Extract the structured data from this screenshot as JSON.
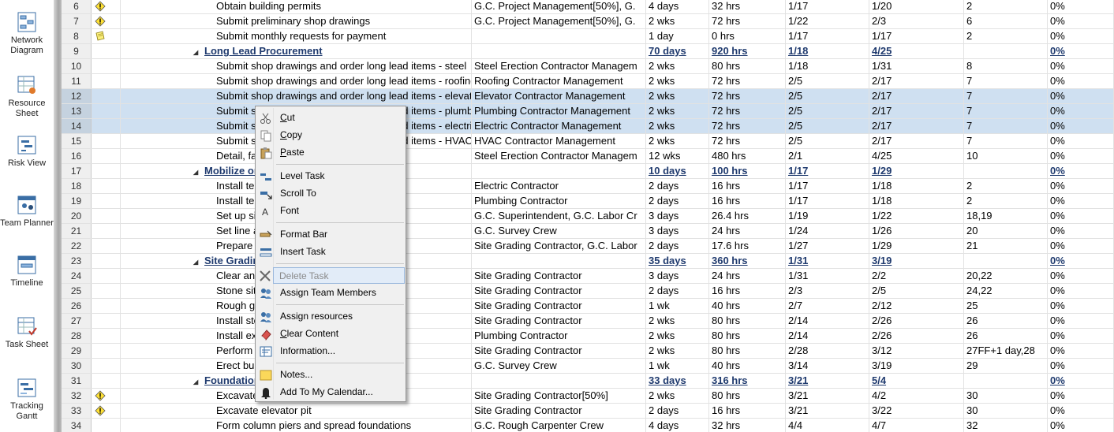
{
  "views": [
    {
      "label": "Network Diagram",
      "icon": "network-diagram-icon"
    },
    {
      "label": "Resource Sheet",
      "icon": "resource-sheet-icon"
    },
    {
      "label": "Risk View",
      "icon": "risk-view-icon"
    },
    {
      "label": "Team Planner",
      "icon": "team-planner-icon"
    },
    {
      "label": "Timeline",
      "icon": "timeline-icon"
    },
    {
      "label": "Task Sheet",
      "icon": "task-sheet-icon"
    },
    {
      "label": "Tracking Gantt",
      "icon": "tracking-gantt-icon"
    }
  ],
  "rows": [
    {
      "id": "6",
      "ind": "warning",
      "name": "Obtain building permits",
      "res": "G.C. Project Management[50%],  G.",
      "dur": "4 days",
      "work": "32 hrs",
      "start": "1/17",
      "finish": "1/20",
      "pred": "2",
      "pct": "0%"
    },
    {
      "id": "7",
      "ind": "warning",
      "name": "Submit preliminary shop drawings",
      "res": "G.C. Project Management[50%],  G.",
      "dur": "2 wks",
      "work": "72 hrs",
      "start": "1/22",
      "finish": "2/3",
      "pred": "6",
      "pct": "0%"
    },
    {
      "id": "8",
      "ind": "note",
      "name": "Submit monthly requests for payment",
      "res": "",
      "dur": "1 day",
      "work": "0 hrs",
      "start": "1/17",
      "finish": "1/17",
      "pred": "2",
      "pct": "0%"
    },
    {
      "id": "9",
      "ind": "",
      "summary": true,
      "name": "Long Lead Procurement",
      "res": "",
      "dur": "70 days",
      "work": "920 hrs",
      "start": "1/18",
      "finish": "4/25",
      "pred": "",
      "pct": "0%"
    },
    {
      "id": "10",
      "ind": "",
      "name": "Submit shop drawings and order long lead items - steel",
      "res": "Steel Erection Contractor Managem",
      "dur": "2 wks",
      "work": "80 hrs",
      "start": "1/18",
      "finish": "1/31",
      "pred": "8",
      "pct": "0%"
    },
    {
      "id": "11",
      "ind": "",
      "name": "Submit shop drawings and order long lead items - roofing",
      "res": "Roofing Contractor Management",
      "dur": "2 wks",
      "work": "72 hrs",
      "start": "2/5",
      "finish": "2/17",
      "pred": "7",
      "pct": "0%"
    },
    {
      "id": "12",
      "ind": "",
      "sel": true,
      "name": "Submit shop drawings and order long lead items - elevator",
      "res": "Elevator Contractor Management",
      "dur": "2 wks",
      "work": "72 hrs",
      "start": "2/5",
      "finish": "2/17",
      "pred": "7",
      "pct": "0%"
    },
    {
      "id": "13",
      "ind": "",
      "sel": true,
      "name": "Submit shop drawings and order long lead items - plumbing",
      "res": "Plumbing Contractor Management",
      "dur": "2 wks",
      "work": "72 hrs",
      "start": "2/5",
      "finish": "2/17",
      "pred": "7",
      "pct": "0%"
    },
    {
      "id": "14",
      "ind": "",
      "sel": true,
      "active": true,
      "name": "Submit shop drawings and order long lead items - electric",
      "res": "Electric Contractor Management",
      "dur": "2 wks",
      "work": "72 hrs",
      "start": "2/5",
      "finish": "2/17",
      "pred": "7",
      "pct": "0%"
    },
    {
      "id": "15",
      "ind": "",
      "name": "Submit shop drawings and order long lead items - HVAC",
      "res": "HVAC Contractor Management",
      "dur": "2 wks",
      "work": "72 hrs",
      "start": "2/5",
      "finish": "2/17",
      "pred": "7",
      "pct": "0%"
    },
    {
      "id": "16",
      "ind": "",
      "name": "Detail, fabricate and deliver steel",
      "res": "Steel Erection Contractor Managem",
      "dur": "12 wks",
      "work": "480 hrs",
      "start": "2/1",
      "finish": "4/25",
      "pred": "10",
      "pct": "0%"
    },
    {
      "id": "17",
      "ind": "",
      "summary": true,
      "name": "Mobilize on Site",
      "res": "",
      "dur": "10 days",
      "work": "100 hrs",
      "start": "1/17",
      "finish": "1/29",
      "pred": "",
      "pct": "0%"
    },
    {
      "id": "18",
      "ind": "",
      "name": "Install temporary power",
      "res": "Electric Contractor",
      "dur": "2 days",
      "work": "16 hrs",
      "start": "1/17",
      "finish": "1/18",
      "pred": "2",
      "pct": "0%"
    },
    {
      "id": "19",
      "ind": "",
      "name": "Install temporary water service",
      "res": "Plumbing Contractor",
      "dur": "2 days",
      "work": "16 hrs",
      "start": "1/17",
      "finish": "1/18",
      "pred": "2",
      "pct": "0%"
    },
    {
      "id": "20",
      "ind": "",
      "name": "Set up site office",
      "res": "G.C. Superintendent,  G.C. Labor Cr",
      "dur": "3 days",
      "work": "26.4 hrs",
      "start": "1/19",
      "finish": "1/22",
      "pred": "18,19",
      "pct": "0%"
    },
    {
      "id": "21",
      "ind": "",
      "name": "Set line and grade benchmarks",
      "res": "G.C. Survey Crew",
      "dur": "3 days",
      "work": "24 hrs",
      "start": "1/24",
      "finish": "1/26",
      "pred": "20",
      "pct": "0%"
    },
    {
      "id": "22",
      "ind": "",
      "name": "Prepare site - lay down yard",
      "res": "Site Grading Contractor,  G.C. Labor",
      "dur": "2 days",
      "work": "17.6 hrs",
      "start": "1/27",
      "finish": "1/29",
      "pred": "21",
      "pct": "0%"
    },
    {
      "id": "23",
      "ind": "",
      "summary": true,
      "name": "Site Grading and Utilities",
      "res": "",
      "dur": "35 days",
      "work": "360 hrs",
      "start": "1/31",
      "finish": "3/19",
      "pred": "",
      "pct": "0%"
    },
    {
      "id": "24",
      "ind": "",
      "name": "Clear and grub site",
      "res": "Site Grading Contractor",
      "dur": "3 days",
      "work": "24 hrs",
      "start": "1/31",
      "finish": "2/2",
      "pred": "20,22",
      "pct": "0%"
    },
    {
      "id": "25",
      "ind": "",
      "name": "Stone site access and temporary parking",
      "res": "Site Grading Contractor",
      "dur": "2 days",
      "work": "16 hrs",
      "start": "2/3",
      "finish": "2/5",
      "pred": "24,22",
      "pct": "0%"
    },
    {
      "id": "26",
      "ind": "",
      "name": "Rough grade site (cut and fill)",
      "res": "Site Grading Contractor",
      "dur": "1 wk",
      "work": "40 hrs",
      "start": "2/7",
      "finish": "2/12",
      "pred": "25",
      "pct": "0%"
    },
    {
      "id": "27",
      "ind": "",
      "name": "Install storm drainage",
      "res": "Site Grading Contractor",
      "dur": "2 wks",
      "work": "80 hrs",
      "start": "2/14",
      "finish": "2/26",
      "pred": "26",
      "pct": "0%"
    },
    {
      "id": "28",
      "ind": "",
      "name": "Install exterior fire lines",
      "res": "Plumbing Contractor",
      "dur": "2 wks",
      "work": "80 hrs",
      "start": "2/14",
      "finish": "2/26",
      "pred": "26",
      "pct": "0%"
    },
    {
      "id": "29",
      "ind": "",
      "name": "Perform final site grading",
      "res": "Site Grading Contractor",
      "dur": "2 wks",
      "work": "80 hrs",
      "start": "2/28",
      "finish": "3/12",
      "pred": "27FF+1 day,28",
      "pct": "0%"
    },
    {
      "id": "30",
      "ind": "",
      "name": "Erect building batter boards",
      "res": "G.C. Survey Crew",
      "dur": "1 wk",
      "work": "40 hrs",
      "start": "3/14",
      "finish": "3/19",
      "pred": "29",
      "pct": "0%"
    },
    {
      "id": "31",
      "ind": "",
      "summary": true,
      "name": "Foundations",
      "res": "",
      "dur": "33 days",
      "work": "316 hrs",
      "start": "3/21",
      "finish": "5/4",
      "pred": "",
      "pct": "0%"
    },
    {
      "id": "32",
      "ind": "warning",
      "name": "Excavate foundations",
      "res": "Site Grading Contractor[50%]",
      "dur": "2 wks",
      "work": "80 hrs",
      "start": "3/21",
      "finish": "4/2",
      "pred": "30",
      "pct": "0%"
    },
    {
      "id": "33",
      "ind": "warning",
      "name": "Excavate elevator pit",
      "res": "Site Grading Contractor",
      "dur": "2 days",
      "work": "16 hrs",
      "start": "3/21",
      "finish": "3/22",
      "pred": "30",
      "pct": "0%"
    },
    {
      "id": "34",
      "ind": "",
      "name": "Form column piers and spread foundations",
      "res": "G.C. Rough Carpenter Crew",
      "dur": "4 days",
      "work": "32 hrs",
      "start": "4/4",
      "finish": "4/7",
      "pred": "32",
      "pct": "0%"
    }
  ],
  "context_menu": [
    {
      "label": "Cut",
      "icon": "scissors-icon",
      "sep_after": false
    },
    {
      "label": "Copy",
      "icon": "copy-icon",
      "sep_after": false
    },
    {
      "label": "Paste",
      "icon": "paste-icon",
      "sep_after": true
    },
    {
      "label": "Level Task",
      "icon": "level-task-icon",
      "sep_after": false
    },
    {
      "label": "Scroll To",
      "icon": "scroll-to-icon",
      "sep_after": false
    },
    {
      "label": "Font",
      "icon": "font-icon",
      "sep_after": true
    },
    {
      "label": "Format Bar",
      "icon": "format-bar-icon",
      "sep_after": false
    },
    {
      "label": "Insert Task",
      "icon": "insert-task-icon",
      "sep_after": true
    },
    {
      "label": "Delete Task",
      "icon": "delete-task-icon",
      "highlighted": true,
      "sep_after": false
    },
    {
      "label": "Assign Team Members",
      "icon": "team-members-icon",
      "sep_after": true
    },
    {
      "label": "Assign resources",
      "icon": "assign-resources-icon",
      "sep_after": false
    },
    {
      "label": "Clear Content",
      "icon": "eraser-icon",
      "sep_after": false
    },
    {
      "label": "Information...",
      "icon": "information-icon",
      "sep_after": true
    },
    {
      "label": "Notes...",
      "icon": "notes-icon",
      "sep_after": false
    },
    {
      "label": "Add To My Calendar...",
      "icon": "bell-icon",
      "sep_after": false
    }
  ],
  "colors": {
    "selection": "#cfe0f1",
    "summary_text": "#1f3a6e",
    "menu_bg": "#f0f0f0",
    "highlight": "#e2ecf8"
  }
}
